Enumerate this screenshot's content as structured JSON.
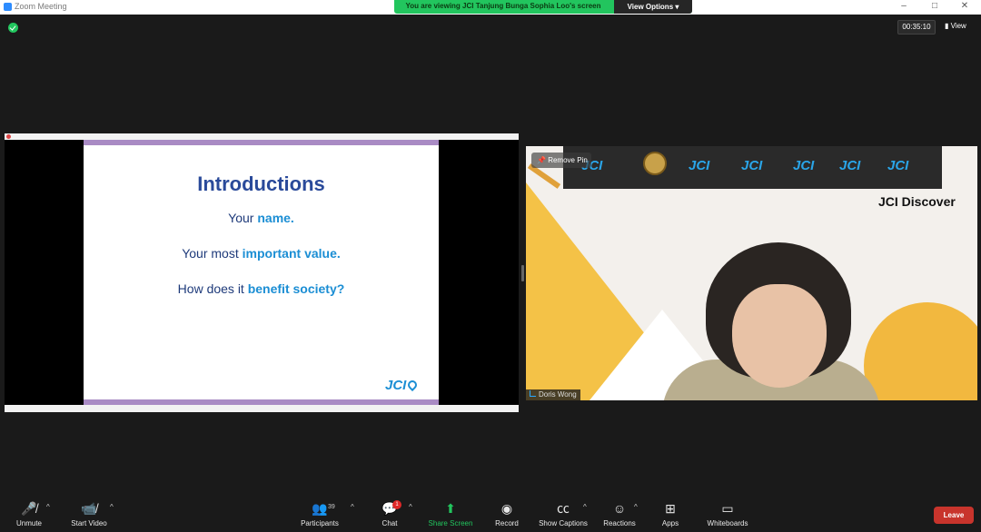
{
  "window": {
    "title": "Zoom Meeting",
    "minimize_label": "–",
    "maximize_label": "□",
    "close_label": "✕"
  },
  "share_banner": {
    "text": "You are viewing JCI Tanjung Bunga Sophia Loo's screen",
    "view_options_label": "View Options ▾"
  },
  "meeting": {
    "timer": "00:35:10",
    "view_label": "▮ View"
  },
  "slide": {
    "title": "Introductions",
    "lines": [
      {
        "prefix": "Your ",
        "highlight": "name."
      },
      {
        "prefix": "Your most ",
        "highlight": "important value."
      },
      {
        "prefix": "How does it ",
        "highlight": "benefit society?"
      }
    ],
    "logo": "JCI"
  },
  "video": {
    "remove_pin_label": "Remove Pin",
    "participant_name": "Doris Wong",
    "background_text": "JCI Discover",
    "sponsor_logos": [
      "JCI",
      "JCI",
      "JCI",
      "JCI",
      "JCI",
      "JCI"
    ]
  },
  "toolbar": {
    "unmute_label": "Unmute",
    "start_video_label": "Start Video",
    "participants_label": "Participants",
    "participants_count": "39",
    "chat_label": "Chat",
    "chat_badge": "1",
    "share_screen_label": "Share Screen",
    "record_label": "Record",
    "show_captions_label": "Show Captions",
    "reactions_label": "Reactions",
    "apps_label": "Apps",
    "whiteboards_label": "Whiteboards",
    "leave_label": "Leave"
  },
  "colors": {
    "accent_green": "#22c55e",
    "leave_red": "#c8342c",
    "slide_blue": "#1b8ed4",
    "slide_navy": "#2a4a9a"
  }
}
